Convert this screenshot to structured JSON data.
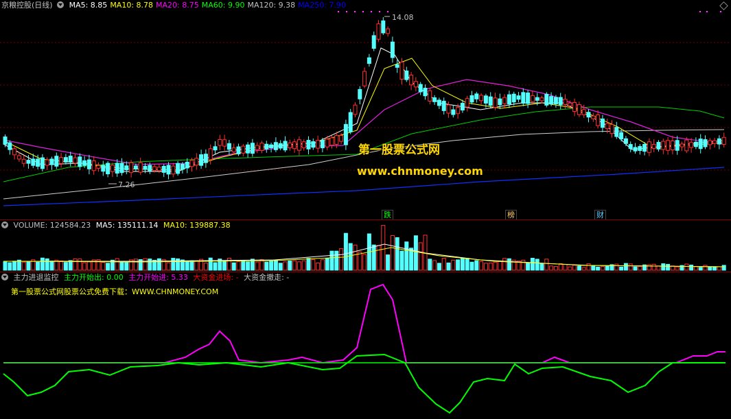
{
  "main": {
    "title": "京粮控股(日线)",
    "ma": [
      {
        "label": "MA5: 8.85",
        "color": "#ffffff"
      },
      {
        "label": "MA10: 8.78",
        "color": "#ffff00"
      },
      {
        "label": "MA20: 8.75",
        "color": "#ff00ff"
      },
      {
        "label": "MA60: 9.90",
        "color": "#00ff00"
      },
      {
        "label": "MA120: 9.38",
        "color": "#c0c0c0"
      },
      {
        "label": "MA250: 7.90",
        "color": "#0000ff"
      }
    ],
    "high_label": "14.08",
    "low_label": "7.26",
    "watermark_title": "第一股票公式网",
    "watermark_url": "www.chnmoney.com",
    "events": [
      {
        "label": "跌",
        "color": "#00ff00"
      },
      {
        "label": "榜",
        "color": "#ffcc66"
      },
      {
        "label": "财",
        "color": "#66ccff"
      }
    ]
  },
  "volume": {
    "label": "VOLUME: 124584.23",
    "ma5": "MA5: 135111.14",
    "ma10": "MA10: 139887.38"
  },
  "indicator": {
    "name": "主力进退监控",
    "items": [
      {
        "label": "主力开始出: 0.00",
        "color": "#00ff00"
      },
      {
        "label": "主力开始进: 5.33",
        "color": "#ff00ff"
      },
      {
        "label": "大资金进场: -",
        "color": "#ff0000"
      },
      {
        "label": "大资金撤走: -",
        "color": "#c0c0c0"
      }
    ],
    "download": "第一股票公式网股票公式免费下载：WWW.CHNMONEY.COM"
  },
  "icons": [
    "collapse-circle-icon",
    "diamond-icon"
  ]
}
